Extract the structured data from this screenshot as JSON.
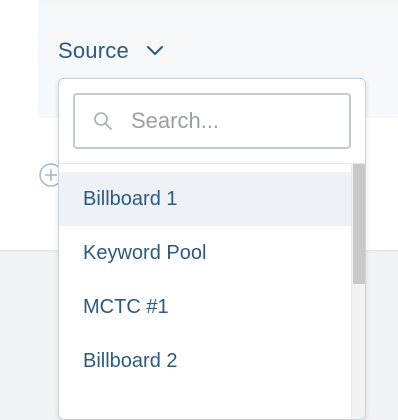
{
  "source": {
    "label": "Source",
    "expanded": true
  },
  "search": {
    "placeholder": "Search...",
    "value": ""
  },
  "options": [
    {
      "label": "Billboard 1",
      "highlighted": true
    },
    {
      "label": "Keyword Pool",
      "highlighted": false
    },
    {
      "label": "MCTC #1",
      "highlighted": false
    },
    {
      "label": "Billboard 2",
      "highlighted": false
    }
  ],
  "colors": {
    "text": "#2d5a80",
    "border": "#c8d3dd",
    "highlight": "#eef2f6",
    "placeholder": "#9aa0a6"
  },
  "icons": {
    "chevron": "chevron-down-icon",
    "search": "search-icon",
    "add": "add-icon"
  }
}
